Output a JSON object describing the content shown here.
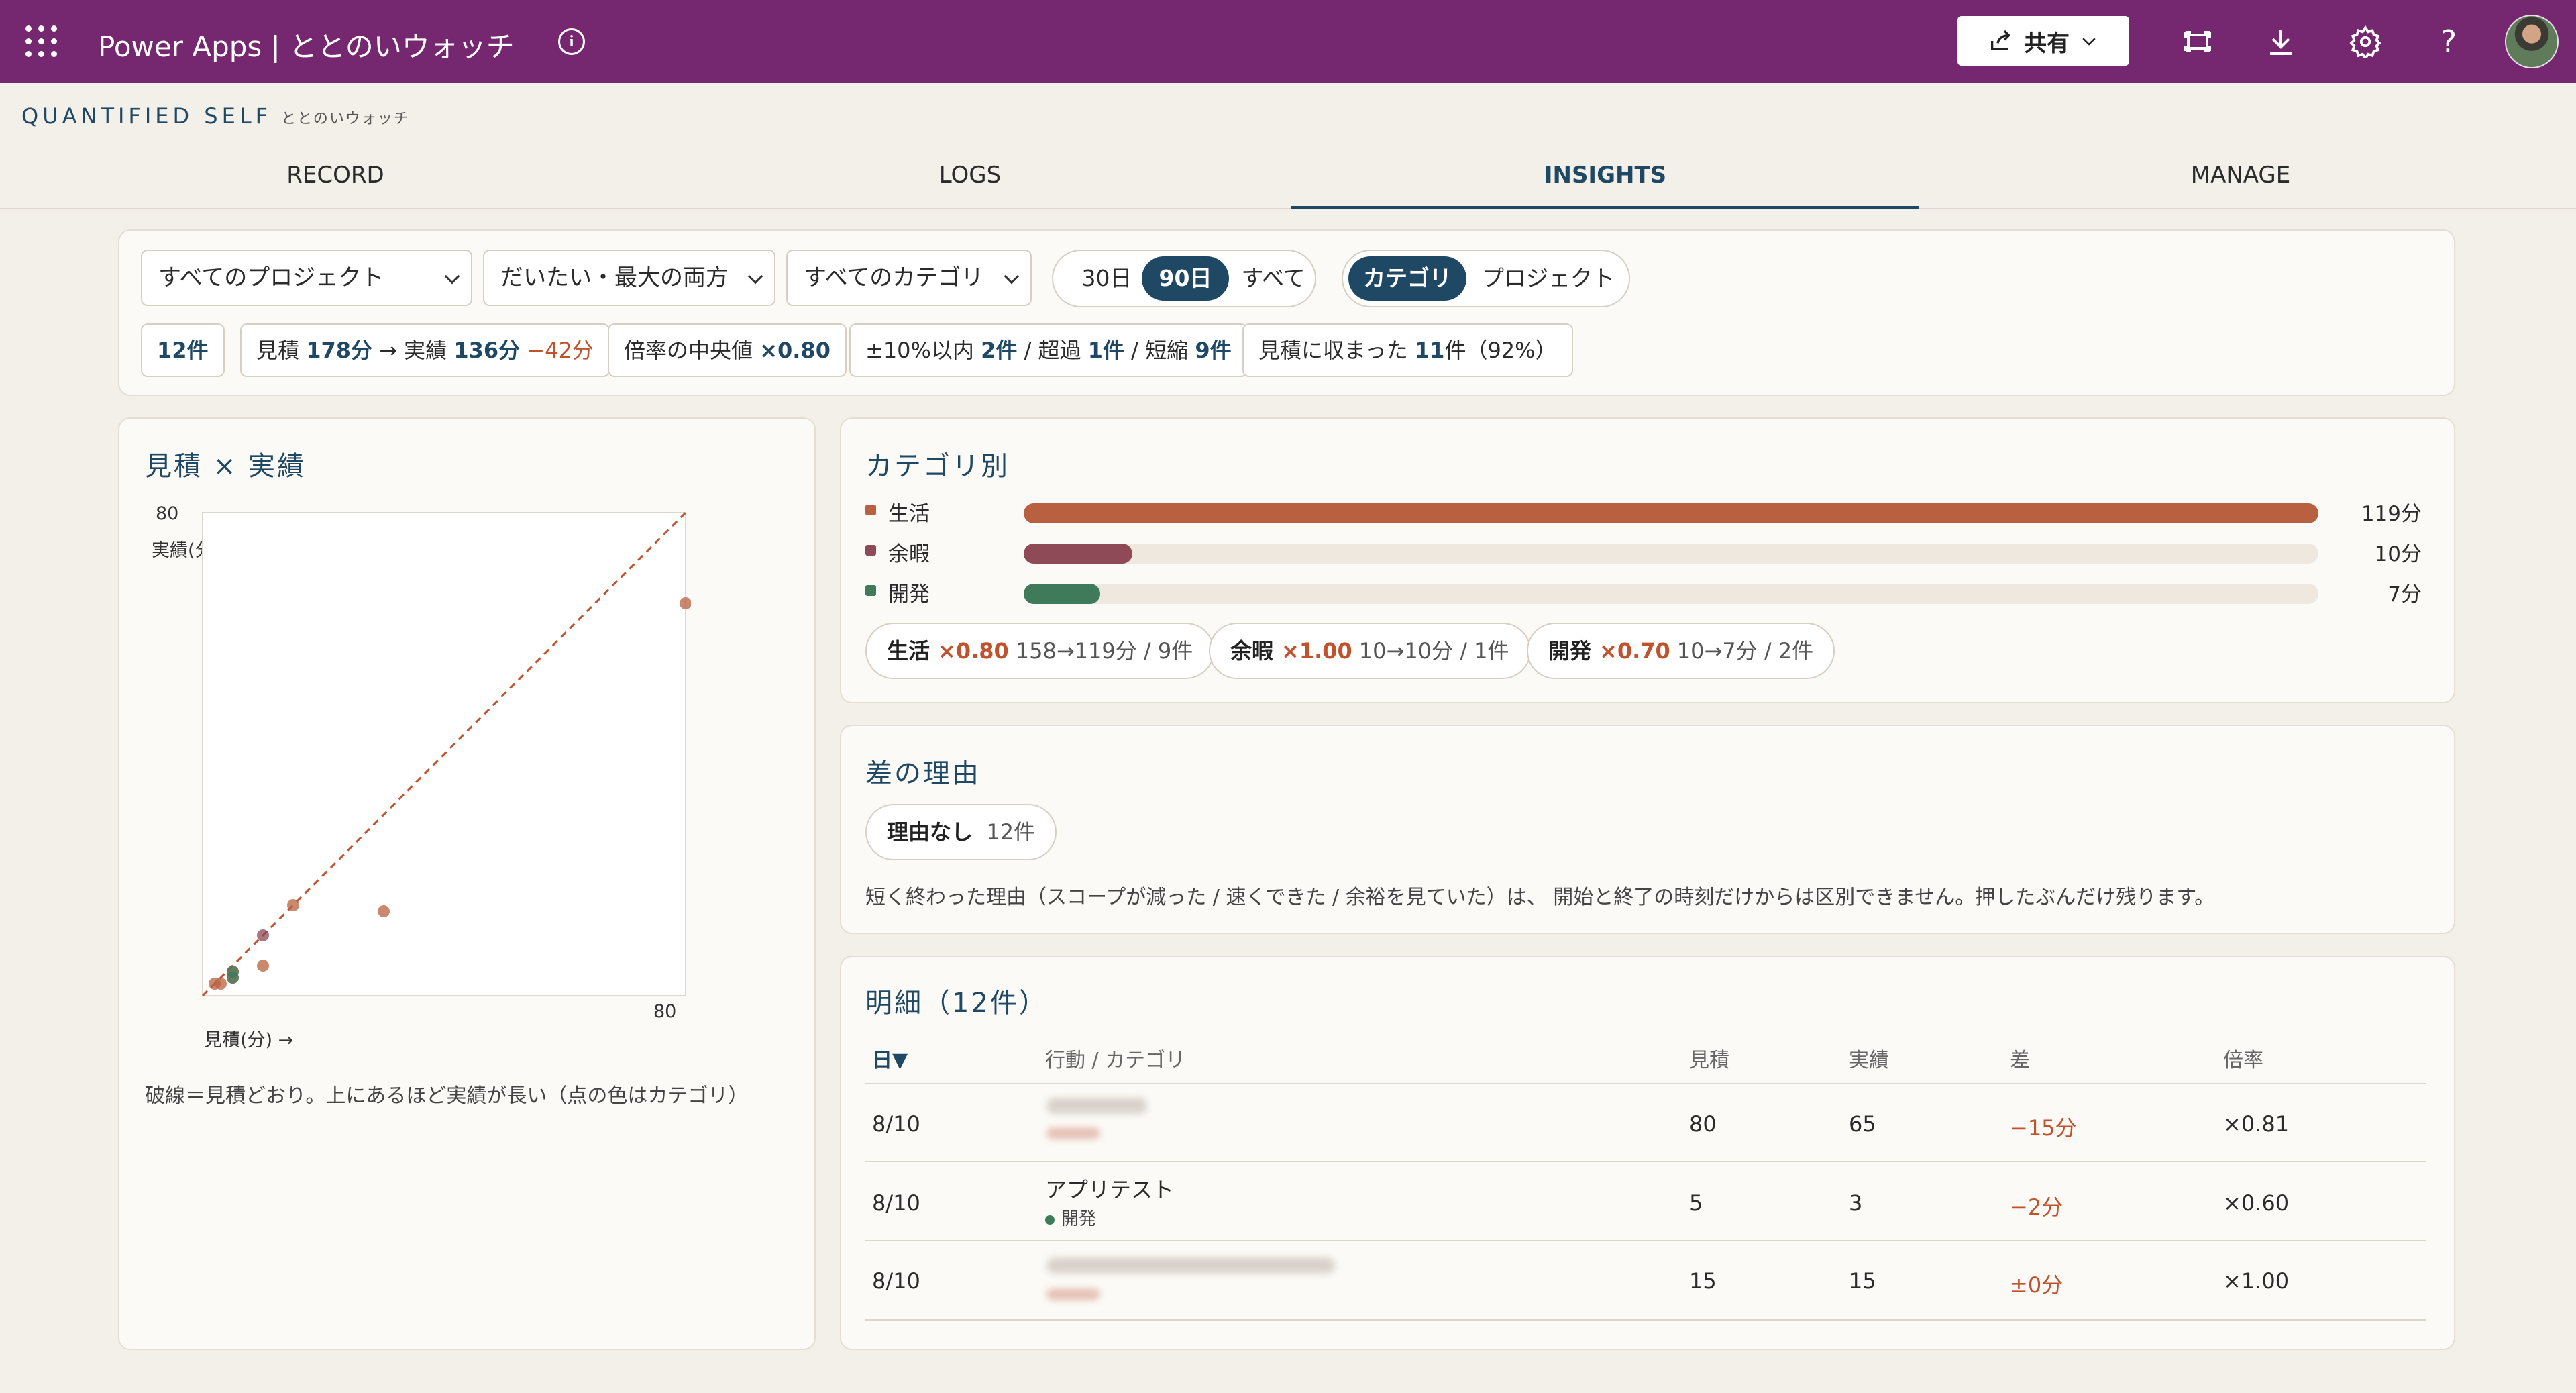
{
  "topbar": {
    "app_title": "Power Apps | ととのいウォッチ",
    "share_label": "共有",
    "icons": [
      "waffle-icon",
      "info-icon",
      "share-icon",
      "chevron-down-icon",
      "fit-screen-icon",
      "download-icon",
      "gear-icon",
      "help-icon",
      "avatar"
    ]
  },
  "brand": {
    "title": "QUANTIFIED SELF",
    "subtitle": "ととのいウォッチ"
  },
  "tabs": [
    {
      "label": "RECORD"
    },
    {
      "label": "LOGS"
    },
    {
      "label": "INSIGHTS",
      "active": true
    },
    {
      "label": "MANAGE"
    }
  ],
  "filters": {
    "project": "すべてのプロジェクト",
    "mode": "だいたい・最大の両方",
    "category": "すべてのカテゴリ",
    "range_options": [
      "30日",
      "90日",
      "すべて"
    ],
    "range_selected": "90日",
    "group_options": [
      "カテゴリ",
      "プロジェクト"
    ],
    "group_selected": "カテゴリ"
  },
  "stats": {
    "count": "12件",
    "est_label": "見積",
    "est_value": "178分",
    "arrow": "→",
    "act_label": "実績",
    "act_value": "136分",
    "diff": "−42分",
    "median_label": "倍率の中央値",
    "median_value": "×0.80",
    "within_label": "±10%以内",
    "within_value": "2件",
    "over_label": "/ 超過",
    "over_value": "1件",
    "short_label": "/ 短縮",
    "short_value": "9件",
    "fit_label": "見積に収まった",
    "fit_value": "11",
    "fit_suffix": "件（92%）"
  },
  "scatter": {
    "title": "見積 × 実績",
    "y_max_label": "80",
    "y_axis_label": "実績(分)",
    "x_max_label": "80",
    "x_axis_label": "見積(分) →",
    "note": "破線＝見積どおり。上にあるほど実績が長い（点の色はカテゴリ）"
  },
  "chart_data": {
    "type": "scatter",
    "title": "見積 × 実績",
    "xlabel": "見積(分)",
    "ylabel": "実績(分)",
    "xlim": [
      0,
      80
    ],
    "ylim": [
      0,
      80
    ],
    "reference_line": "y = x (dashed)",
    "series": [
      {
        "name": "生活",
        "color": "#b8603f",
        "points": [
          [
            80,
            65
          ],
          [
            15,
            15
          ],
          [
            30,
            14
          ],
          [
            10,
            5
          ],
          [
            5,
            3
          ],
          [
            5,
            4
          ],
          [
            3,
            2
          ],
          [
            2,
            2
          ]
        ]
      },
      {
        "name": "余暇",
        "color": "#8e4a57",
        "points": [
          [
            10,
            10
          ]
        ]
      },
      {
        "name": "開発",
        "color": "#3f7a5b",
        "points": [
          [
            5,
            3
          ],
          [
            5,
            4
          ]
        ]
      }
    ]
  },
  "categories": {
    "title": "カテゴリ別",
    "rows": [
      {
        "name": "生活",
        "value": "119分",
        "minutes": 119,
        "color": "#b8603f"
      },
      {
        "name": "余暇",
        "value": "10分",
        "minutes": 10,
        "color": "#8e4a57"
      },
      {
        "name": "開発",
        "value": "7分",
        "minutes": 7,
        "color": "#3f7a5b"
      }
    ],
    "pills": [
      {
        "name": "生活",
        "mult": "×0.80",
        "detail": "158→119分 / 9件"
      },
      {
        "name": "余暇",
        "mult": "×1.00",
        "detail": "10→10分 / 1件"
      },
      {
        "name": "開発",
        "mult": "×0.70",
        "detail": "10→7分 / 2件"
      }
    ]
  },
  "reasons": {
    "title": "差の理由",
    "pill_name": "理由なし",
    "pill_count": "12件",
    "note": "短く終わった理由（スコープが減った / 速くできた / 余裕を見ていた）は、 開始と終了の時刻だけからは区別できません。押したぶんだけ残ります。"
  },
  "details": {
    "title": "明細（12件）",
    "columns": [
      "日▼",
      "行動 / カテゴリ",
      "見積",
      "実績",
      "差",
      "倍率"
    ],
    "rows": [
      {
        "date": "8/10",
        "action": "",
        "category": "",
        "est": "80",
        "act": "65",
        "diff": "−15分",
        "ratio": "×0.81"
      },
      {
        "date": "8/10",
        "action": "アプリテスト",
        "category": "開発",
        "est": "5",
        "act": "3",
        "diff": "−2分",
        "ratio": "×0.60"
      },
      {
        "date": "8/10",
        "action": "",
        "category": "",
        "est": "15",
        "act": "15",
        "diff": "±0分",
        "ratio": "×1.00"
      }
    ]
  },
  "colors": {
    "topbar": "#75276f",
    "accent": "#1f4865",
    "negative": "#c0532e",
    "life": "#b8603f",
    "leisure": "#8e4a57",
    "dev": "#3f7a5b"
  }
}
